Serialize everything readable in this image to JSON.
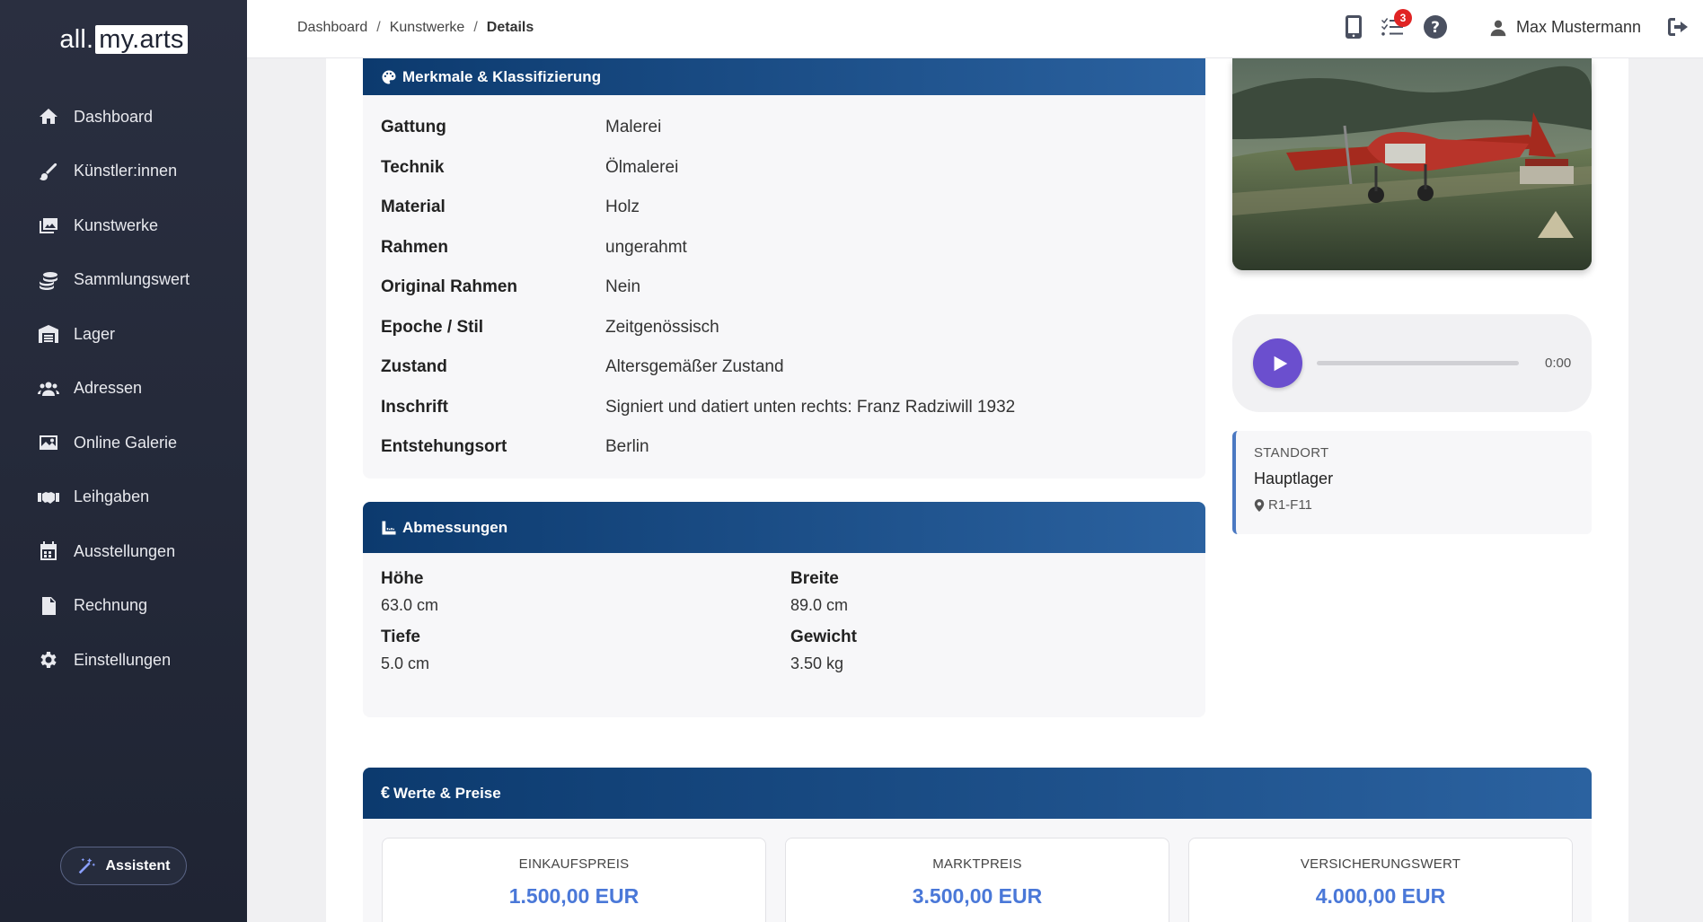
{
  "app": {
    "logo_left": "all.",
    "logo_right": "my.arts"
  },
  "sidebar": {
    "items": [
      {
        "label": "Dashboard",
        "icon": "home-icon"
      },
      {
        "label": "Künstler:innen",
        "icon": "brush-icon"
      },
      {
        "label": "Kunstwerke",
        "icon": "images-icon"
      },
      {
        "label": "Sammlungswert",
        "icon": "coins-icon"
      },
      {
        "label": "Lager",
        "icon": "warehouse-icon"
      },
      {
        "label": "Adressen",
        "icon": "users-icon"
      },
      {
        "label": "Online Galerie",
        "icon": "image-icon"
      },
      {
        "label": "Leihgaben",
        "icon": "handshake-icon"
      },
      {
        "label": "Ausstellungen",
        "icon": "calendar-icon"
      },
      {
        "label": "Rechnung",
        "icon": "invoice-icon"
      },
      {
        "label": "Einstellungen",
        "icon": "gear-icon"
      }
    ],
    "assistant_label": "Assistent"
  },
  "header": {
    "breadcrumb": [
      "Dashboard",
      "Kunstwerke",
      "Details"
    ],
    "task_count": "3",
    "user_name": "Max Mustermann"
  },
  "features": {
    "title": "Merkmale & Klassifizierung",
    "rows": [
      {
        "key": "Gattung",
        "value": "Malerei"
      },
      {
        "key": "Technik",
        "value": "Ölmalerei"
      },
      {
        "key": "Material",
        "value": "Holz"
      },
      {
        "key": "Rahmen",
        "value": "ungerahmt"
      },
      {
        "key": "Original Rahmen",
        "value": "Nein"
      },
      {
        "key": "Epoche / Stil",
        "value": "Zeitgenössisch"
      },
      {
        "key": "Zustand",
        "value": "Altersgemäßer Zustand"
      },
      {
        "key": "Inschrift",
        "value": "Signiert und datiert unten rechts: Franz Radziwill 1932"
      },
      {
        "key": "Entstehungsort",
        "value": "Berlin"
      }
    ]
  },
  "dimensions": {
    "title": "Abmessungen",
    "items": [
      {
        "key": "Höhe",
        "value": "63.0 cm"
      },
      {
        "key": "Breite",
        "value": "89.0 cm"
      },
      {
        "key": "Tiefe",
        "value": "5.0 cm"
      },
      {
        "key": "Gewicht",
        "value": "3.50 kg"
      }
    ]
  },
  "audio": {
    "time": "0:00",
    "progress": 0
  },
  "location": {
    "label": "STANDORT",
    "name": "Hauptlager",
    "code": "R1-F11"
  },
  "prices": {
    "title": "Werte & Preise",
    "items": [
      {
        "label": "EINKAUFSPREIS",
        "value": "1.500,00 EUR"
      },
      {
        "label": "MARKTPREIS",
        "value": "3.500,00 EUR"
      },
      {
        "label": "VERSICHERUNGSWERT",
        "value": "4.000,00 EUR"
      }
    ]
  },
  "colors": {
    "header_gradient_start": "#0c3a6e",
    "header_gradient_end": "#2b62a0",
    "price_text": "#4a78d8",
    "play_button": "#6b4fce",
    "sidebar_bg": "#262c3d"
  }
}
